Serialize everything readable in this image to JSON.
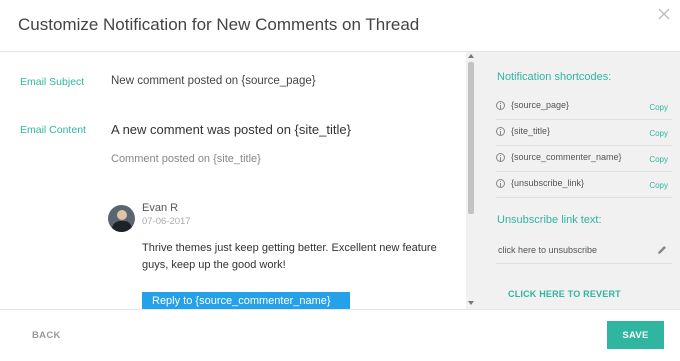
{
  "dialog": {
    "title": "Customize Notification for New Comments on Thread"
  },
  "form": {
    "subject_label": "Email Subject",
    "subject_value": "New comment posted on {source_page}",
    "content_label": "Email Content",
    "heading": "A new comment was posted on {site_title}",
    "subheading": "Comment posted on {site_title}"
  },
  "comment": {
    "author": "Evan R",
    "date": "07-06-2017",
    "text_line1": "Thrive themes just keep getting better. Excellent new feature",
    "text_line2": "guys, keep up the good work!",
    "reply_button": "Reply to {source_commenter_name}"
  },
  "sidebar": {
    "title": "Notification shortcodes:",
    "shortcodes": [
      {
        "code": "{source_page}",
        "copy": "Copy"
      },
      {
        "code": "{site_title}",
        "copy": "Copy"
      },
      {
        "code": "{source_commenter_name}",
        "copy": "Copy"
      },
      {
        "code": "{unsubscribe_link}",
        "copy": "Copy"
      }
    ],
    "unsubscribe_title": "Unsubscribe link text:",
    "unsubscribe_text": "click here to unsubscribe",
    "revert": "CLICK HERE TO REVERT"
  },
  "footer": {
    "back": "BACK",
    "save": "SAVE"
  },
  "colors": {
    "accent": "#2fb5a0",
    "reply_button": "#24a1e8",
    "sidebar_bg": "#f1f1f1"
  },
  "icons": [
    "close-icon",
    "info-icon",
    "pencil-icon",
    "avatar"
  ]
}
